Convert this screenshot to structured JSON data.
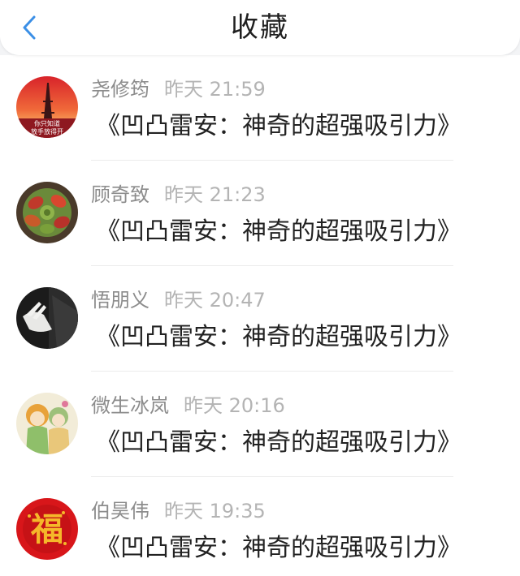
{
  "header": {
    "title": "收藏",
    "back_icon": "chevron-left-icon",
    "accent_color": "#3b8fe6"
  },
  "items": [
    {
      "username": "尧修筠",
      "time": "昨天 21:59",
      "content": "《凹凸雷安：神奇的超强吸引力》",
      "avatar_icon": "eiffel-tower-sunset-avatar",
      "avatar_text": [
        "你只知道",
        "放手放得开"
      ]
    },
    {
      "username": "顾奇致",
      "time": "昨天 21:23",
      "content": "《凹凸雷安：神奇的超强吸引力》",
      "avatar_icon": "succulent-plant-avatar"
    },
    {
      "username": "悟朋义",
      "time": "昨天 20:47",
      "content": "《凹凸雷安：神奇的超强吸引力》",
      "avatar_icon": "hand-photo-avatar"
    },
    {
      "username": "微生冰岚",
      "time": "昨天 20:16",
      "content": "《凹凸雷安：神奇的超强吸引力》",
      "avatar_icon": "illustrated-girls-avatar"
    },
    {
      "username": "伯昊伟",
      "time": "昨天 19:35",
      "content": "《凹凸雷安：神奇的超强吸引力》",
      "avatar_icon": "fortune-character-avatar",
      "avatar_text": [
        "福"
      ]
    }
  ]
}
